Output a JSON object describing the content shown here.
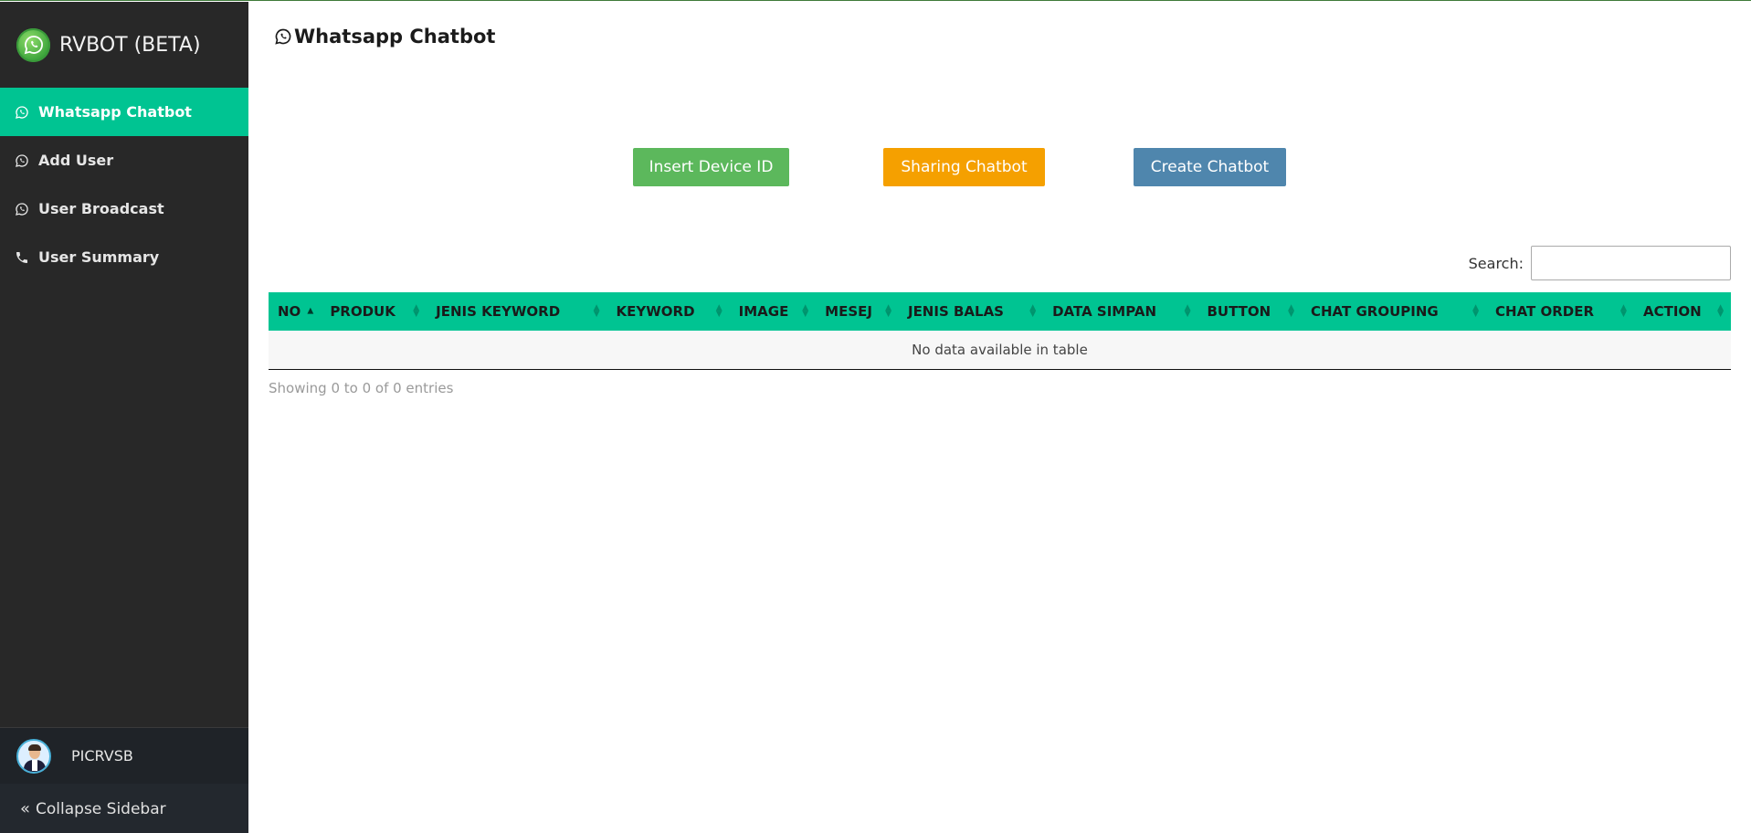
{
  "brand": {
    "title": "RVBOT (BETA)"
  },
  "sidebar": {
    "items": [
      {
        "label": "Whatsapp Chatbot",
        "icon": "whatsapp-icon",
        "active": true
      },
      {
        "label": "Add User",
        "icon": "whatsapp-icon",
        "active": false
      },
      {
        "label": "User Broadcast",
        "icon": "whatsapp-icon",
        "active": false
      },
      {
        "label": "User Summary",
        "icon": "phone-icon",
        "active": false
      }
    ],
    "user": {
      "name": "PICRVSB"
    },
    "collapse_label": "Collapse Sidebar"
  },
  "main": {
    "title": "Whatsapp Chatbot",
    "buttons": {
      "insert": "Insert Device ID",
      "sharing": "Sharing Chatbot",
      "create": "Create Chatbot"
    },
    "search": {
      "label": "Search:",
      "value": ""
    },
    "table": {
      "columns": [
        "NO",
        "PRODUK",
        "JENIS KEYWORD",
        "KEYWORD",
        "IMAGE",
        "MESEJ",
        "JENIS BALAS",
        "DATA SIMPAN",
        "BUTTON",
        "CHAT GROUPING",
        "CHAT ORDER",
        "ACTION"
      ],
      "empty_text": "No data available in table",
      "info": "Showing 0 to 0 of 0 entries"
    }
  },
  "colors": {
    "accent": "#00c492",
    "sidebar_bg": "#282828",
    "btn_green": "#5cb85c",
    "btn_orange": "#f5a000",
    "btn_blue": "#4f86ad"
  }
}
